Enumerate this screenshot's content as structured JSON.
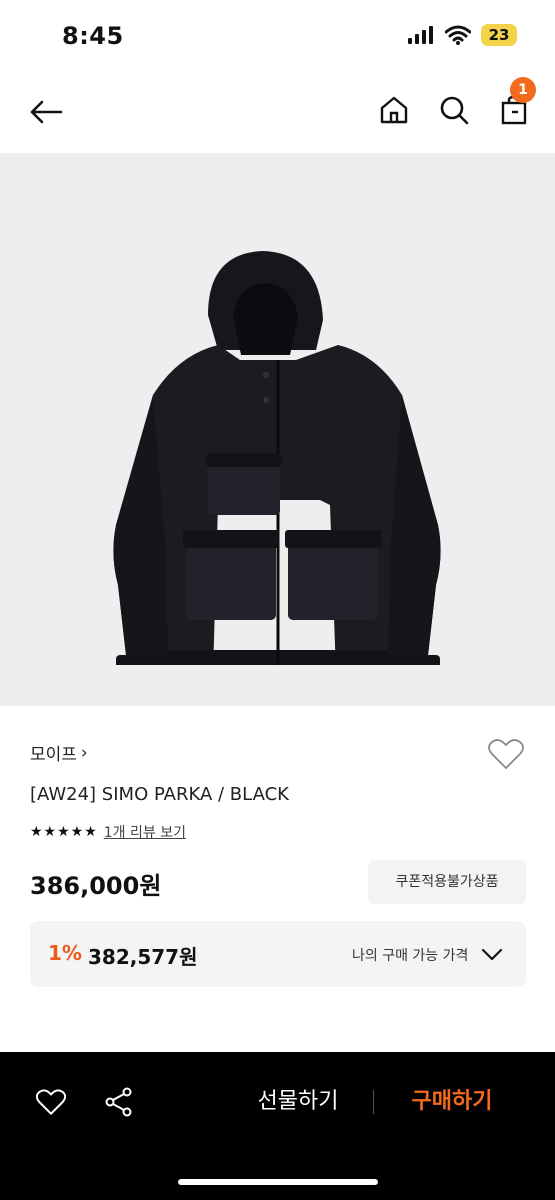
{
  "status_bar": {
    "time": "8:45",
    "battery": "23"
  },
  "header": {
    "cart_count": "1"
  },
  "product": {
    "brand": "모이프",
    "brand_chevron": "›",
    "title": "[AW24] SIMO PARKA / BLACK",
    "stars": "★★★★★",
    "rating_stars": 5,
    "review_link": "1개 리뷰 보기",
    "price": "386,000원",
    "coupon_text": "쿠폰적용불가상품",
    "my_price": {
      "discount_rate": "1%",
      "price": "382,577원",
      "label": "나의 구매 가능 가격"
    }
  },
  "bottom_bar": {
    "gift_label": "선물하기",
    "buy_label": "구매하기"
  },
  "colors": {
    "accent": "#f26a1b",
    "image_bg": "#eeeeee",
    "bottom_bar": "#000000"
  },
  "icons": [
    "back-arrow-icon",
    "home-icon",
    "search-icon",
    "shopping-bag-icon",
    "heart-icon",
    "share-icon",
    "chevron-down-icon"
  ]
}
